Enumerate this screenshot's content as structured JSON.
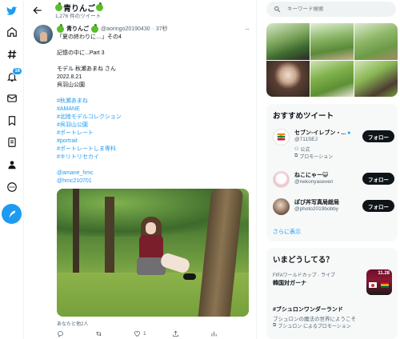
{
  "header": {
    "title": "青りんご",
    "tweet_count": "1,276 件のツイート"
  },
  "tweet": {
    "display_name": "青りんご",
    "handle": "@aoringo20190430",
    "time": "· 37秒",
    "more": "···",
    "lines": [
      "「夏の終わりに…」その4",
      "",
      "記憶の中に...Part 3",
      "",
      "モデル 秋瀬あまね さん",
      "2022.8.21",
      "呉羽山公園"
    ],
    "hashtags": [
      "#秋瀬あまね",
      "#AMANE",
      "#北陸モデルコレクション",
      "#呉羽山公園",
      "#ポートレート",
      "#portrait",
      "#ポートレートしま専科",
      "#キリトリセカイ"
    ],
    "mentions": [
      "@amane_hmc",
      "@hmc210701"
    ],
    "caption": "あなたと他2人",
    "actions": {
      "reply": "",
      "retweet": "",
      "like": "1",
      "share": ""
    }
  },
  "nav": {
    "notifications_badge": "16",
    "items": [
      "twitter-logo",
      "home",
      "explore",
      "notifications",
      "messages",
      "bookmarks",
      "lists",
      "profile",
      "more"
    ]
  },
  "search": {
    "placeholder": "キーワード検索"
  },
  "recommend": {
    "title": "おすすめツイート",
    "accounts": [
      {
        "name": "セブン-イレブン・...",
        "handle": "@711SEJ",
        "extra1": "公式",
        "extra2": "プロモーション",
        "follow": "フォロー"
      },
      {
        "name": "ねこにゃー😺",
        "handle": "@nekonyaseven",
        "follow": "フォロー"
      },
      {
        "name": "ぽび丼写真局総局",
        "handle": "@photo2019bobby",
        "follow": "フォロー"
      }
    ],
    "show_more": "さらに表示"
  },
  "trends": {
    "title": "いまどうしてる？",
    "items": [
      {
        "meta": "FIFAワールドカップ · ライブ",
        "name": "韓国対ガーナ",
        "thumb_text": "11.28"
      },
      {
        "meta": "",
        "name": "#ブシュロンワンダーランド",
        "desc": "ブシュロンの魔法の世界にようこそ",
        "promo": "ブシュロン によるプロモーション"
      }
    ]
  },
  "colors": {
    "accent": "#1d9bf0",
    "text": "#0f1419",
    "muted": "#536471",
    "follow_bg": "#0f1419"
  }
}
